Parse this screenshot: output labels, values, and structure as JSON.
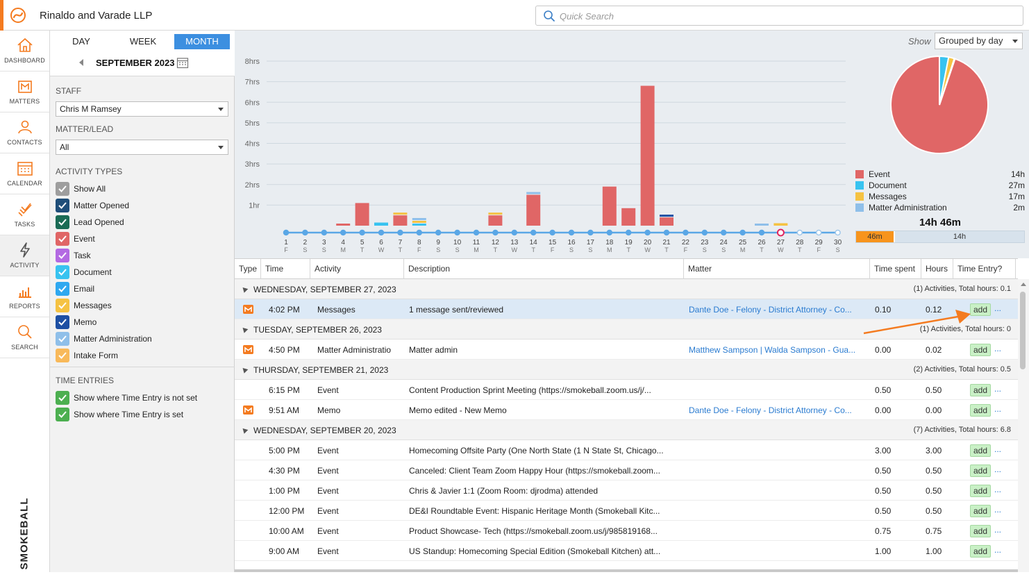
{
  "app": {
    "firm_name": "Rinaldo and Varade LLP",
    "brand": "SMOKEBALL",
    "accent_color": "#f47b20"
  },
  "search": {
    "placeholder": "Quick Search"
  },
  "nav": [
    {
      "label": "DASHBOARD",
      "icon": "house-icon"
    },
    {
      "label": "MATTERS",
      "icon": "matter-icon"
    },
    {
      "label": "CONTACTS",
      "icon": "contacts-icon"
    },
    {
      "label": "CALENDAR",
      "icon": "calendar-icon"
    },
    {
      "label": "TASKS",
      "icon": "tasks-icon"
    },
    {
      "label": "ACTIVITY",
      "icon": "lightning-icon",
      "active": true
    },
    {
      "label": "REPORTS",
      "icon": "reports-icon"
    },
    {
      "label": "SEARCH",
      "icon": "search-icon"
    }
  ],
  "range": {
    "day": "DAY",
    "week": "WEEK",
    "month": "MONTH",
    "active": "month",
    "current_label": "SEPTEMBER 2023"
  },
  "filters": {
    "staff_label": "STAFF",
    "staff_value": "Chris M Ramsey",
    "matter_label": "MATTER/LEAD",
    "matter_value": "All",
    "activity_types_label": "ACTIVITY TYPES",
    "activity_types": [
      {
        "label": "Show All",
        "color": "#9e9e9e"
      },
      {
        "label": "Matter Opened",
        "color": "#1f4e79"
      },
      {
        "label": "Lead Opened",
        "color": "#1a6b55"
      },
      {
        "label": "Event",
        "color": "#e06666"
      },
      {
        "label": "Task",
        "color": "#b36ae2"
      },
      {
        "label": "Document",
        "color": "#38c3f0"
      },
      {
        "label": "Email",
        "color": "#2fa8f0"
      },
      {
        "label": "Messages",
        "color": "#f5c242"
      },
      {
        "label": "Memo",
        "color": "#1d4fa3"
      },
      {
        "label": "Matter Administration",
        "color": "#8fbfe9"
      },
      {
        "label": "Intake Form",
        "color": "#f8b95a"
      }
    ],
    "time_entries_label": "TIME ENTRIES",
    "time_entries": [
      {
        "label": "Show where Time Entry is not set",
        "color": "#4caf50"
      },
      {
        "label": "Show where Time Entry is set",
        "color": "#4caf50"
      }
    ]
  },
  "show": {
    "label": "Show",
    "value": "Grouped by day"
  },
  "chart_data": {
    "type": "bar",
    "ylim": [
      0,
      8
    ],
    "y_ticks": [
      "8hrs",
      "7hrs",
      "6hrs",
      "5hrs",
      "4hrs",
      "3hrs",
      "2hrs",
      "1hr"
    ],
    "y_tick_values": [
      8,
      7,
      6,
      5,
      4,
      3,
      2,
      1
    ],
    "days": [
      "1",
      "2",
      "3",
      "4",
      "5",
      "6",
      "7",
      "8",
      "9",
      "10",
      "11",
      "12",
      "13",
      "14",
      "15",
      "16",
      "17",
      "18",
      "19",
      "20",
      "21",
      "22",
      "23",
      "24",
      "25",
      "26",
      "27",
      "28",
      "29",
      "30"
    ],
    "weekdays": [
      "F",
      "S",
      "S",
      "M",
      "T",
      "W",
      "T",
      "F",
      "S",
      "S",
      "M",
      "T",
      "W",
      "T",
      "F",
      "S",
      "S",
      "M",
      "T",
      "W",
      "T",
      "F",
      "S",
      "S",
      "M",
      "T",
      "W",
      "T",
      "F",
      "S"
    ],
    "today_index": 26,
    "series": [
      {
        "name": "Event",
        "color": "#e06666",
        "values": [
          0,
          0,
          0,
          0.1,
          1.1,
          0,
          0.5,
          0,
          0,
          0,
          0,
          0.5,
          0,
          1.5,
          0,
          0,
          0,
          1.9,
          0.85,
          6.8,
          0.4,
          0,
          0,
          0,
          0,
          0,
          0,
          0,
          0,
          0
        ]
      },
      {
        "name": "Document",
        "color": "#38c3f0",
        "values": [
          0,
          0,
          0,
          0,
          0,
          0.15,
          0,
          0.1,
          0,
          0,
          0,
          0,
          0,
          0,
          0,
          0,
          0,
          0,
          0,
          0,
          0,
          0,
          0,
          0,
          0,
          0,
          0,
          0,
          0,
          0
        ]
      },
      {
        "name": "Messages",
        "color": "#f5c242",
        "values": [
          0,
          0,
          0,
          0,
          0,
          0,
          0.1,
          0.1,
          0,
          0,
          0,
          0.1,
          0,
          0,
          0,
          0,
          0,
          0,
          0,
          0,
          0,
          0,
          0,
          0,
          0,
          0,
          0.12,
          0,
          0,
          0
        ]
      },
      {
        "name": "Matter Administration",
        "color": "#8fbfe9",
        "values": [
          0,
          0,
          0,
          0,
          0,
          0,
          0,
          0.05,
          0,
          0,
          0,
          0,
          0,
          0.1,
          0,
          0,
          0,
          0,
          0,
          0,
          0,
          0,
          0,
          0,
          0,
          0.02,
          0,
          0,
          0,
          0
        ]
      },
      {
        "name": "Memo",
        "color": "#1d4fa3",
        "values": [
          0,
          0,
          0,
          0,
          0,
          0,
          0,
          0,
          0,
          0,
          0,
          0,
          0,
          0,
          0,
          0,
          0,
          0,
          0,
          0,
          0.1,
          0,
          0,
          0,
          0,
          0,
          0,
          0,
          0,
          0
        ]
      }
    ]
  },
  "pie_data": {
    "type": "pie",
    "slices": [
      {
        "name": "Event",
        "value": 840,
        "color": "#e06666"
      },
      {
        "name": "Document",
        "value": 27,
        "color": "#38c3f0"
      },
      {
        "name": "Messages",
        "value": 17,
        "color": "#f5c242"
      },
      {
        "name": "Matter Administration",
        "value": 2,
        "color": "#8fbfe9"
      }
    ]
  },
  "legend": [
    {
      "name": "Event",
      "value": "14h",
      "color": "#e06666"
    },
    {
      "name": "Document",
      "value": "27m",
      "color": "#38c3f0"
    },
    {
      "name": "Messages",
      "value": "17m",
      "color": "#f5c242"
    },
    {
      "name": "Matter Administration",
      "value": "2m",
      "color": "#8fbfe9"
    }
  ],
  "totals": {
    "total": "14h 46m",
    "seg1": "46m",
    "seg2": "14h",
    "seg1_fraction": 0.22
  },
  "table": {
    "headers": {
      "type": "Type",
      "time": "Time",
      "activity": "Activity",
      "description": "Description",
      "matter": "Matter",
      "time_spent": "Time spent",
      "hours": "Hours",
      "time_entry": "Time Entry?"
    },
    "add_label": "add",
    "more_label": "...",
    "groups": [
      {
        "label": "WEDNESDAY, SEPTEMBER 27, 2023",
        "summary": "(1) Activities, Total hours: 0.1",
        "rows": [
          {
            "icon": true,
            "time": "4:02 PM",
            "activity": "Messages",
            "description": "1 message sent/reviewed",
            "matter": "Dante Doe - Felony - District Attorney - Co...",
            "time_spent": "0.10",
            "hours": "0.12",
            "selected": true
          }
        ]
      },
      {
        "label": "TUESDAY, SEPTEMBER 26, 2023",
        "summary": "(1) Activities, Total hours: 0",
        "rows": [
          {
            "icon": true,
            "time": "4:50 PM",
            "activity": "Matter Administratio",
            "description": "Matter admin",
            "matter": "Matthew Sampson | Walda Sampson - Gua...",
            "time_spent": "0.00",
            "hours": "0.02"
          }
        ]
      },
      {
        "label": "THURSDAY, SEPTEMBER 21, 2023",
        "summary": "(2) Activities, Total hours: 0.5",
        "rows": [
          {
            "icon": false,
            "time": "6:15 PM",
            "activity": "Event",
            "description": "Content Production Sprint Meeting (https://smokeball.zoom.us/j/...",
            "matter": "",
            "time_spent": "0.50",
            "hours": "0.50"
          },
          {
            "icon": true,
            "time": "9:51 AM",
            "activity": "Memo",
            "description": "Memo edited - New Memo",
            "matter": "Dante Doe - Felony - District Attorney - Co...",
            "time_spent": "0.00",
            "hours": "0.00"
          }
        ]
      },
      {
        "label": "WEDNESDAY, SEPTEMBER 20, 2023",
        "summary": "(7) Activities, Total hours: 6.8",
        "rows": [
          {
            "icon": false,
            "time": "5:00 PM",
            "activity": "Event",
            "description": "Homecoming Offsite Party (One North State (1 N State St, Chicago...",
            "matter": "",
            "time_spent": "3.00",
            "hours": "3.00"
          },
          {
            "icon": false,
            "time": "4:30 PM",
            "activity": "Event",
            "description": "Canceled: Client Team Zoom Happy Hour (https://smokeball.zoom...",
            "matter": "",
            "time_spent": "0.50",
            "hours": "0.50"
          },
          {
            "icon": false,
            "time": "1:00 PM",
            "activity": "Event",
            "description": "Chris & Javier 1:1 (Zoom Room: djrodma) attended",
            "matter": "",
            "time_spent": "0.50",
            "hours": "0.50"
          },
          {
            "icon": false,
            "time": "12:00 PM",
            "activity": "Event",
            "description": "DE&I Roundtable Event: Hispanic Heritage Month  (Smokeball Kitc...",
            "matter": "",
            "time_spent": "0.50",
            "hours": "0.50"
          },
          {
            "icon": false,
            "time": "10:00 AM",
            "activity": "Event",
            "description": "Product Showcase- Tech (https://smokeball.zoom.us/j/985819168...",
            "matter": "",
            "time_spent": "0.75",
            "hours": "0.75"
          },
          {
            "icon": false,
            "time": "9:00 AM",
            "activity": "Event",
            "description": "US Standup: Homecoming Special Edition  (Smokeball Kitchen) att...",
            "matter": "",
            "time_spent": "1.00",
            "hours": "1.00"
          }
        ]
      }
    ]
  }
}
